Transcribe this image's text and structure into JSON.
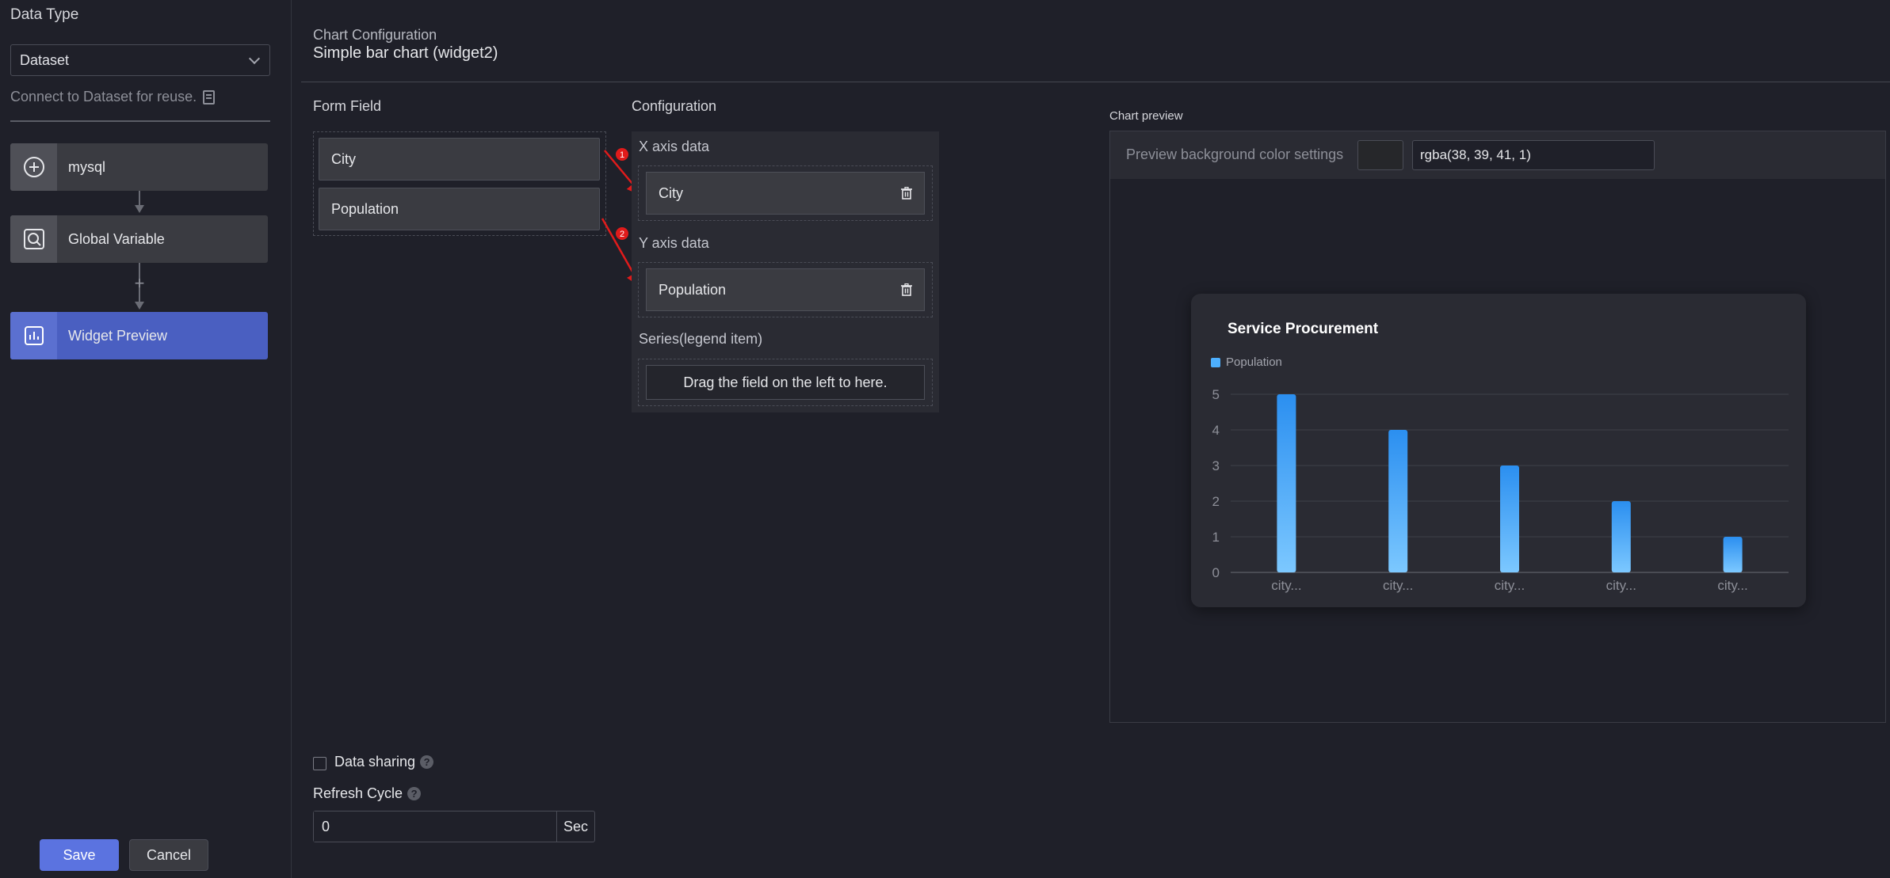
{
  "left_panel": {
    "data_type_label": "Data Type",
    "data_type_value": "Dataset",
    "reuse_hint": "Connect to Dataset for reuse.",
    "nodes": [
      {
        "label": "mysql",
        "icon": "plus-circle-icon"
      },
      {
        "label": "Global Variable",
        "icon": "variable-search-icon"
      },
      {
        "label": "Widget Preview",
        "icon": "chart-icon",
        "active": true
      }
    ],
    "save_label": "Save",
    "cancel_label": "Cancel"
  },
  "header": {
    "subtitle": "Chart Configuration",
    "title": "Simple bar chart (widget2)"
  },
  "form_field": {
    "label": "Form Field",
    "items": [
      "City",
      "Population"
    ]
  },
  "configuration": {
    "label": "Configuration",
    "x_axis_label": "X axis data",
    "x_axis_value": "City",
    "y_axis_label": "Y axis data",
    "y_axis_value": "Population",
    "series_label": "Series(legend item)",
    "series_hint": "Drag the field on the left to here.",
    "markers": [
      "1",
      "2"
    ]
  },
  "preview": {
    "label": "Chart preview",
    "bg_setting_label": "Preview background color settings",
    "bg_color_value": "rgba(38, 39, 41, 1)"
  },
  "chart_data": {
    "type": "bar",
    "title": "Service Procurement",
    "series": [
      {
        "name": "Population",
        "values": [
          5,
          4,
          3,
          2,
          1
        ]
      }
    ],
    "categories": [
      "city...",
      "city...",
      "city...",
      "city...",
      "city..."
    ],
    "yticks": [
      "0",
      "1",
      "2",
      "3",
      "4",
      "5"
    ],
    "ylim": [
      0,
      5
    ],
    "grid": true,
    "legend": "top-left",
    "bar_color_top": "#2b8ff0",
    "bar_color_bottom": "#7cc8ff"
  },
  "settings": {
    "data_sharing_label": "Data sharing",
    "refresh_cycle_label": "Refresh Cycle",
    "refresh_value": "0",
    "refresh_unit": "Sec"
  }
}
